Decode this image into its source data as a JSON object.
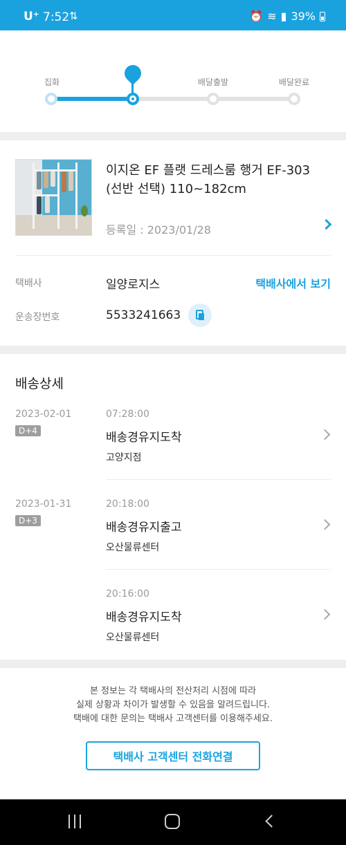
{
  "status_bar": {
    "carrier": "U⁺",
    "time": "7:52",
    "battery": "39%",
    "icons": [
      "network-icon",
      "alarm-icon",
      "wifi-icon",
      "signal-icon",
      "battery-icon"
    ]
  },
  "tracker": {
    "steps": [
      {
        "label": "집화",
        "state": "done"
      },
      {
        "label": "",
        "state": "current"
      },
      {
        "label": "배달출발",
        "state": "pending"
      },
      {
        "label": "배달완료",
        "state": "pending"
      }
    ],
    "active_color": "#1aa2df"
  },
  "product": {
    "title": "이지온 EF 플랫 드레스룸 행거 EF-303 (선반 선택) 110~182cm",
    "date": "등록일 : 2023/01/28"
  },
  "carrier": {
    "label": "택배사",
    "name": "일양로지스",
    "link": "택배사에서 보기"
  },
  "waybill": {
    "label": "운송장번호",
    "number": "5533241663"
  },
  "detail": {
    "title": "배송상세",
    "events": [
      {
        "date": "2023-02-01",
        "badge": "D+4",
        "time": "07:28:00",
        "status": "배송경유지도착",
        "location": "고양지점"
      },
      {
        "date": "2023-01-31",
        "badge": "D+3",
        "time": "20:18:00",
        "status": "배송경유지출고",
        "location": "오산물류센터"
      },
      {
        "date": "",
        "badge": "",
        "time": "20:16:00",
        "status": "배송경유지도착",
        "location": "오산물류센터"
      }
    ]
  },
  "footer": {
    "notice_lines": [
      "본 정보는 각 택배사의 전산처리 시점에 따라",
      "실제 상황과 차이가 발생할 수 있음을 알려드립니다.",
      "택배에 대한 문의는 택배사 고객센터를 이용해주세요."
    ],
    "call_button": "택배사 고객센터 전화연결"
  },
  "navbar": {
    "icons": [
      "recent-apps-icon",
      "home-icon",
      "back-icon"
    ]
  }
}
